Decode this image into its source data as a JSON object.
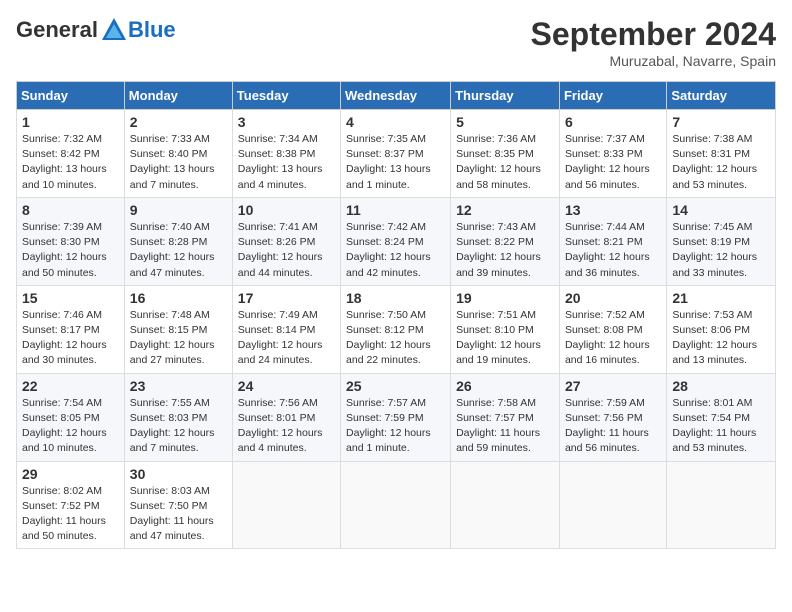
{
  "header": {
    "logo": {
      "text_general": "General",
      "text_blue": "Blue"
    },
    "month_title": "September 2024",
    "location": "Muruzabal, Navarre, Spain"
  },
  "calendar": {
    "days_of_week": [
      "Sunday",
      "Monday",
      "Tuesday",
      "Wednesday",
      "Thursday",
      "Friday",
      "Saturday"
    ],
    "weeks": [
      [
        {
          "day": "1",
          "detail": "Sunrise: 7:32 AM\nSunset: 8:42 PM\nDaylight: 13 hours\nand 10 minutes."
        },
        {
          "day": "2",
          "detail": "Sunrise: 7:33 AM\nSunset: 8:40 PM\nDaylight: 13 hours\nand 7 minutes."
        },
        {
          "day": "3",
          "detail": "Sunrise: 7:34 AM\nSunset: 8:38 PM\nDaylight: 13 hours\nand 4 minutes."
        },
        {
          "day": "4",
          "detail": "Sunrise: 7:35 AM\nSunset: 8:37 PM\nDaylight: 13 hours\nand 1 minute."
        },
        {
          "day": "5",
          "detail": "Sunrise: 7:36 AM\nSunset: 8:35 PM\nDaylight: 12 hours\nand 58 minutes."
        },
        {
          "day": "6",
          "detail": "Sunrise: 7:37 AM\nSunset: 8:33 PM\nDaylight: 12 hours\nand 56 minutes."
        },
        {
          "day": "7",
          "detail": "Sunrise: 7:38 AM\nSunset: 8:31 PM\nDaylight: 12 hours\nand 53 minutes."
        }
      ],
      [
        {
          "day": "8",
          "detail": "Sunrise: 7:39 AM\nSunset: 8:30 PM\nDaylight: 12 hours\nand 50 minutes."
        },
        {
          "day": "9",
          "detail": "Sunrise: 7:40 AM\nSunset: 8:28 PM\nDaylight: 12 hours\nand 47 minutes."
        },
        {
          "day": "10",
          "detail": "Sunrise: 7:41 AM\nSunset: 8:26 PM\nDaylight: 12 hours\nand 44 minutes."
        },
        {
          "day": "11",
          "detail": "Sunrise: 7:42 AM\nSunset: 8:24 PM\nDaylight: 12 hours\nand 42 minutes."
        },
        {
          "day": "12",
          "detail": "Sunrise: 7:43 AM\nSunset: 8:22 PM\nDaylight: 12 hours\nand 39 minutes."
        },
        {
          "day": "13",
          "detail": "Sunrise: 7:44 AM\nSunset: 8:21 PM\nDaylight: 12 hours\nand 36 minutes."
        },
        {
          "day": "14",
          "detail": "Sunrise: 7:45 AM\nSunset: 8:19 PM\nDaylight: 12 hours\nand 33 minutes."
        }
      ],
      [
        {
          "day": "15",
          "detail": "Sunrise: 7:46 AM\nSunset: 8:17 PM\nDaylight: 12 hours\nand 30 minutes."
        },
        {
          "day": "16",
          "detail": "Sunrise: 7:48 AM\nSunset: 8:15 PM\nDaylight: 12 hours\nand 27 minutes."
        },
        {
          "day": "17",
          "detail": "Sunrise: 7:49 AM\nSunset: 8:14 PM\nDaylight: 12 hours\nand 24 minutes."
        },
        {
          "day": "18",
          "detail": "Sunrise: 7:50 AM\nSunset: 8:12 PM\nDaylight: 12 hours\nand 22 minutes."
        },
        {
          "day": "19",
          "detail": "Sunrise: 7:51 AM\nSunset: 8:10 PM\nDaylight: 12 hours\nand 19 minutes."
        },
        {
          "day": "20",
          "detail": "Sunrise: 7:52 AM\nSunset: 8:08 PM\nDaylight: 12 hours\nand 16 minutes."
        },
        {
          "day": "21",
          "detail": "Sunrise: 7:53 AM\nSunset: 8:06 PM\nDaylight: 12 hours\nand 13 minutes."
        }
      ],
      [
        {
          "day": "22",
          "detail": "Sunrise: 7:54 AM\nSunset: 8:05 PM\nDaylight: 12 hours\nand 10 minutes."
        },
        {
          "day": "23",
          "detail": "Sunrise: 7:55 AM\nSunset: 8:03 PM\nDaylight: 12 hours\nand 7 minutes."
        },
        {
          "day": "24",
          "detail": "Sunrise: 7:56 AM\nSunset: 8:01 PM\nDaylight: 12 hours\nand 4 minutes."
        },
        {
          "day": "25",
          "detail": "Sunrise: 7:57 AM\nSunset: 7:59 PM\nDaylight: 12 hours\nand 1 minute."
        },
        {
          "day": "26",
          "detail": "Sunrise: 7:58 AM\nSunset: 7:57 PM\nDaylight: 11 hours\nand 59 minutes."
        },
        {
          "day": "27",
          "detail": "Sunrise: 7:59 AM\nSunset: 7:56 PM\nDaylight: 11 hours\nand 56 minutes."
        },
        {
          "day": "28",
          "detail": "Sunrise: 8:01 AM\nSunset: 7:54 PM\nDaylight: 11 hours\nand 53 minutes."
        }
      ],
      [
        {
          "day": "29",
          "detail": "Sunrise: 8:02 AM\nSunset: 7:52 PM\nDaylight: 11 hours\nand 50 minutes."
        },
        {
          "day": "30",
          "detail": "Sunrise: 8:03 AM\nSunset: 7:50 PM\nDaylight: 11 hours\nand 47 minutes."
        },
        {
          "day": "",
          "detail": ""
        },
        {
          "day": "",
          "detail": ""
        },
        {
          "day": "",
          "detail": ""
        },
        {
          "day": "",
          "detail": ""
        },
        {
          "day": "",
          "detail": ""
        }
      ]
    ]
  }
}
